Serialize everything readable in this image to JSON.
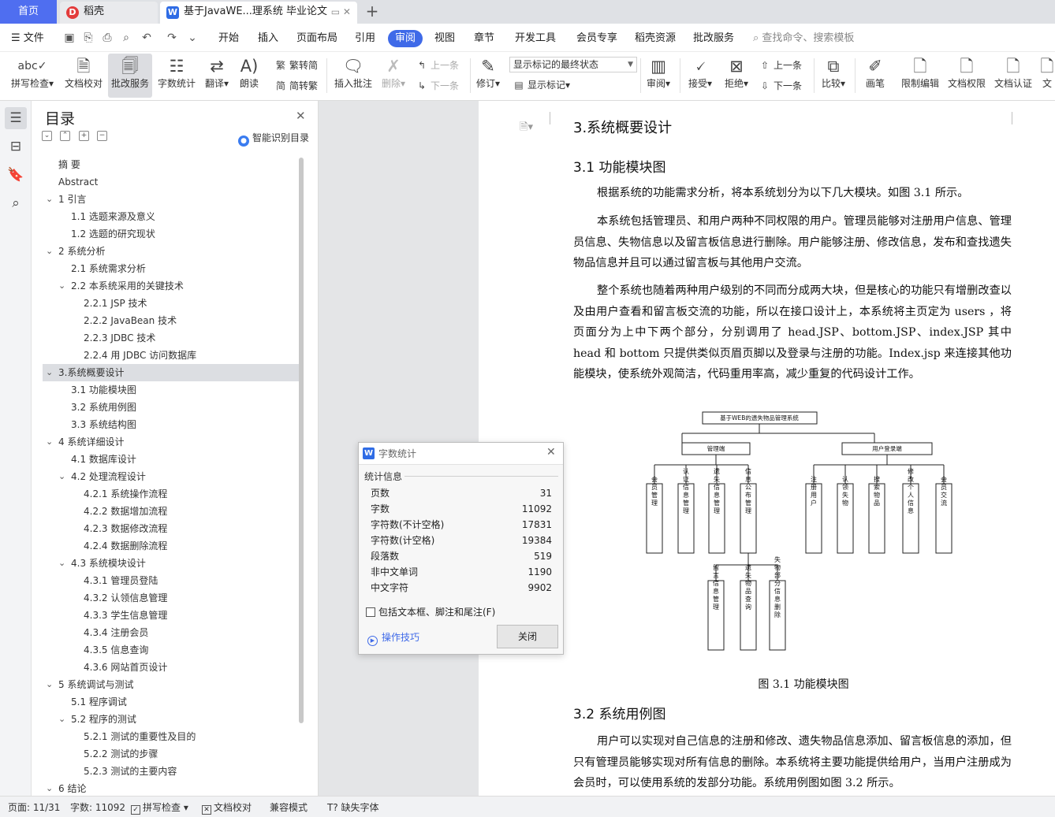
{
  "tabs": {
    "home": "首页",
    "daoke": "稻壳",
    "document": "基于JavaWE...理系统 毕业论文",
    "new_tab": "+"
  },
  "menubar": {
    "file": "文件",
    "items": [
      "开始",
      "插入",
      "页面布局",
      "引用",
      "审阅",
      "视图",
      "章节",
      "开发工具",
      "会员专享",
      "稻壳资源",
      "批改服务"
    ],
    "active": "审阅",
    "search": "查找命令、搜索模板"
  },
  "ribbon": {
    "spellcheck": "拼写检查",
    "doc_proof": "文档校对",
    "grading": "批改服务",
    "word_count": "字数统计",
    "translate": "翻译",
    "read_aloud": "朗读",
    "to_traditional": "繁转简",
    "to_simplified": "简转繁",
    "insert_comment": "插入批注",
    "delete": "删除",
    "prev_comment": "上一条",
    "next_comment": "下一条",
    "revise": "修订",
    "markup_state": "显示标记的最终状态",
    "show_markup": "显示标记",
    "review": "审阅",
    "accept": "接受",
    "reject": "拒绝",
    "prev_change": "上一条",
    "next_change": "下一条",
    "compare": "比较",
    "pen": "画笔",
    "restrict_edit": "限制编辑",
    "doc_permission": "文档权限",
    "doc_cert": "文档认证",
    "doc_more": "文"
  },
  "toc": {
    "title": "目录",
    "smart": "智能识别目录",
    "items": [
      {
        "label": "摘  要",
        "level": 0,
        "toggle": ""
      },
      {
        "label": "Abstract",
        "level": 0,
        "toggle": ""
      },
      {
        "label": "1  引言",
        "level": 0,
        "toggle": "v"
      },
      {
        "label": "1.1  选题来源及意义",
        "level": 1,
        "toggle": ""
      },
      {
        "label": "1.2  选题的研究现状",
        "level": 1,
        "toggle": ""
      },
      {
        "label": "2  系统分析",
        "level": 0,
        "toggle": "v"
      },
      {
        "label": "2.1  系统需求分析",
        "level": 1,
        "toggle": ""
      },
      {
        "label": "2.2  本系统采用的关键技术",
        "level": 1,
        "toggle": "v"
      },
      {
        "label": "2.2.1   JSP 技术",
        "level": 2,
        "toggle": ""
      },
      {
        "label": "2.2.2   JavaBean 技术",
        "level": 2,
        "toggle": ""
      },
      {
        "label": "2.2.3   JDBC 技术",
        "level": 2,
        "toggle": ""
      },
      {
        "label": "2.2.4   用 JDBC 访问数据库",
        "level": 2,
        "toggle": ""
      },
      {
        "label": "3.系统概要设计",
        "level": 0,
        "toggle": "v",
        "selected": true
      },
      {
        "label": "3.1 功能模块图",
        "level": 1,
        "toggle": ""
      },
      {
        "label": "3.2 系统用例图",
        "level": 1,
        "toggle": ""
      },
      {
        "label": "3.3 系统结构图",
        "level": 1,
        "toggle": ""
      },
      {
        "label": "4  系统详细设计",
        "level": 0,
        "toggle": "v"
      },
      {
        "label": "4.1 数据库设计",
        "level": 1,
        "toggle": ""
      },
      {
        "label": "4.2  处理流程设计",
        "level": 1,
        "toggle": "v"
      },
      {
        "label": "4.2.1    系统操作流程",
        "level": 2,
        "toggle": ""
      },
      {
        "label": "4.2.2    数据增加流程",
        "level": 2,
        "toggle": ""
      },
      {
        "label": "4.2.3    数据修改流程",
        "level": 2,
        "toggle": ""
      },
      {
        "label": "4.2.4    数据删除流程",
        "level": 2,
        "toggle": ""
      },
      {
        "label": "4.3  系统模块设计",
        "level": 1,
        "toggle": "v"
      },
      {
        "label": "4.3.1    管理员登陆",
        "level": 2,
        "toggle": ""
      },
      {
        "label": "4.3.2    认领信息管理",
        "level": 2,
        "toggle": ""
      },
      {
        "label": "4.3.3    学生信息管理",
        "level": 2,
        "toggle": ""
      },
      {
        "label": "4.3.4    注册会员",
        "level": 2,
        "toggle": ""
      },
      {
        "label": "4.3.5    信息查询",
        "level": 2,
        "toggle": ""
      },
      {
        "label": "4.3.6    网站首页设计",
        "level": 2,
        "toggle": ""
      },
      {
        "label": "5  系统调试与测试",
        "level": 0,
        "toggle": "v"
      },
      {
        "label": "5.1  程序调试",
        "level": 1,
        "toggle": ""
      },
      {
        "label": "5.2  程序的测试",
        "level": 1,
        "toggle": "v"
      },
      {
        "label": "5.2.1    测试的重要性及目的",
        "level": 2,
        "toggle": ""
      },
      {
        "label": "5.2.2    测试的步骤",
        "level": 2,
        "toggle": ""
      },
      {
        "label": "5.2.3    测试的主要内容",
        "level": 2,
        "toggle": ""
      },
      {
        "label": "6  结论",
        "level": 0,
        "toggle": "v"
      }
    ]
  },
  "document": {
    "heading": "3.系统概要设计",
    "section1": "3.1 功能模块图",
    "para1": "根据系统的功能需求分析，将本系统划分为以下几大模块。如图 3.1 所示。",
    "para2": "本系统包括管理员、和用户两种不同权限的用户。管理员能够对注册用户信息、管理员信息、失物信息以及留言板信息进行删除。用户能够注册、修改信息，发布和查找遗失物品信息并且可以通过留言板与其他用户交流。",
    "para3": "整个系统也随着两种用户级别的不同而分成两大块，但是核心的功能只有增删改查以及由用户查看和留言板交流的功能，所以在接口设计上，本系统将主页定为 users ，将页面分为上中下两个部分，分别调用了 head.JSP、bottom.JSP、index.JSP 其中 head 和 bottom 只提供类似页眉页脚以及登录与注册的功能。Index.jsp 来连接其他功能模块，使系统外观简洁，代码重用率高，减少重复的代码设计工作。",
    "figure_caption": "图 3.1  功能模块图",
    "section2": "3.2 系统用例图",
    "para4": "用户可以实现对自己信息的注册和修改、遗失物品信息添加、留言板信息的添加，但只有管理员能够实现对所有信息的删除。本系统将主要功能提供给用户，当用户注册成为会员时，可以使用系统的发部分功能。系统用例图如图 3.2 所示。"
  },
  "diagram": {
    "root": "基于WEB的遗失物品管理系统",
    "admin": "管理端",
    "user": "用户登录端",
    "admin_children": [
      "会员管理",
      "认证信息管理",
      "遗失信息管理",
      "信息公布管理"
    ],
    "user_children": [
      "注册用户",
      "认领失物",
      "搜索物品",
      "修改个人信息",
      "会员交流"
    ],
    "sub_children": [
      "留言信息管理",
      "遗失物品查询",
      "失物部分信息删除"
    ]
  },
  "dialog": {
    "title": "字数统计",
    "section": "统计信息",
    "stats": [
      {
        "label": "页数",
        "value": "31"
      },
      {
        "label": "字数",
        "value": "11092"
      },
      {
        "label": "字符数(不计空格)",
        "value": "17831"
      },
      {
        "label": "字符数(计空格)",
        "value": "19384"
      },
      {
        "label": "段落数",
        "value": "519"
      },
      {
        "label": "非中文单词",
        "value": "1190"
      },
      {
        "label": "中文字符",
        "value": "9902"
      }
    ],
    "checkbox": "包括文本框、脚注和尾注(F)",
    "tips": "操作技巧",
    "close": "关闭"
  },
  "status": {
    "page": "页面: 11/31",
    "words": "字数: 11092",
    "spell": "拼写检查",
    "proof": "文档校对",
    "compat": "兼容模式",
    "missing_font": "缺失字体"
  },
  "colors": {
    "accent": "#3f6ae8",
    "home_tab": "#4f6ef0"
  }
}
